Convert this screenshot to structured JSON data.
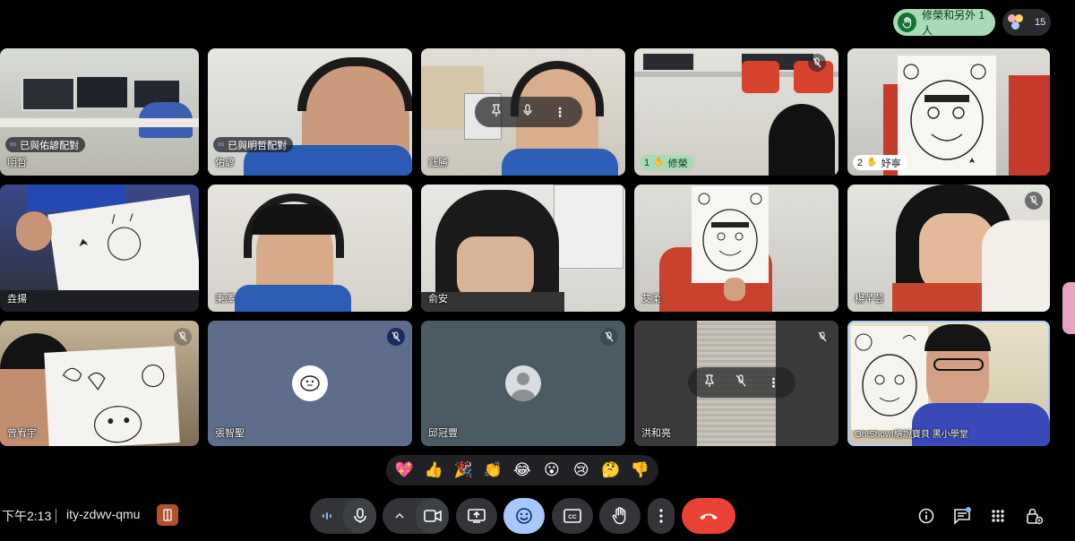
{
  "header": {
    "raised_hands_label": "修榮和另外 1 人",
    "participant_count": "15"
  },
  "tiles": {
    "t1": {
      "name": "明哲",
      "chip": "已與佑諺配對"
    },
    "t2": {
      "name": "佑諺",
      "chip": "已與明哲配對"
    },
    "t3": {
      "name": "鈺勝"
    },
    "t4": {
      "hand_order": "1",
      "name": "修榮"
    },
    "t5": {
      "hand_order": "2",
      "name": "妤寧"
    },
    "t6": {
      "name": "垚揚"
    },
    "t7": {
      "name": "秉澤"
    },
    "t8": {
      "name": "俞安"
    },
    "t9": {
      "name": "艾柔"
    },
    "t10": {
      "name": "楊芊芸"
    },
    "t11": {
      "name": "曾宥宇"
    },
    "t12": {
      "name": "張智聖"
    },
    "t13": {
      "name": "邱冠豐"
    },
    "t14": {
      "name": "洪和亮"
    },
    "t15": {
      "name": "Oh!Show!繪說寶貝 黑小學堂"
    }
  },
  "reactions": [
    "💖",
    "👍",
    "🎉",
    "👏",
    "😂",
    "😮",
    "😢",
    "🤔",
    "👎"
  ],
  "footer": {
    "time": "下午2:13",
    "meeting_code": "ity-zdwv-qmu"
  },
  "colors": {
    "end_call": "#ea4335",
    "active_button": "#a8c7fa",
    "raise_hand_chip": "#a8dab5"
  }
}
